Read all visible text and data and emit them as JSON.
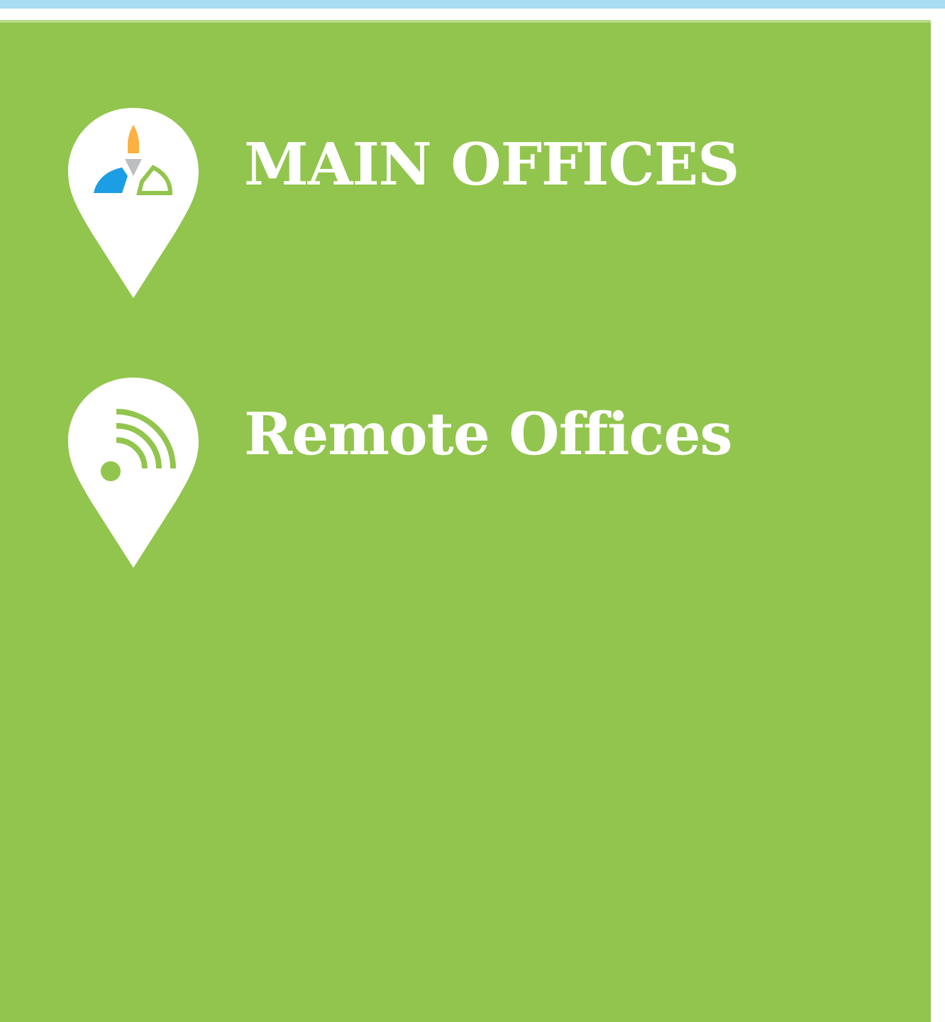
{
  "locations": [
    {
      "kind": "logo",
      "label": "MAIN OFFICES"
    },
    {
      "kind": "signal",
      "label": "Remote Offices"
    }
  ]
}
